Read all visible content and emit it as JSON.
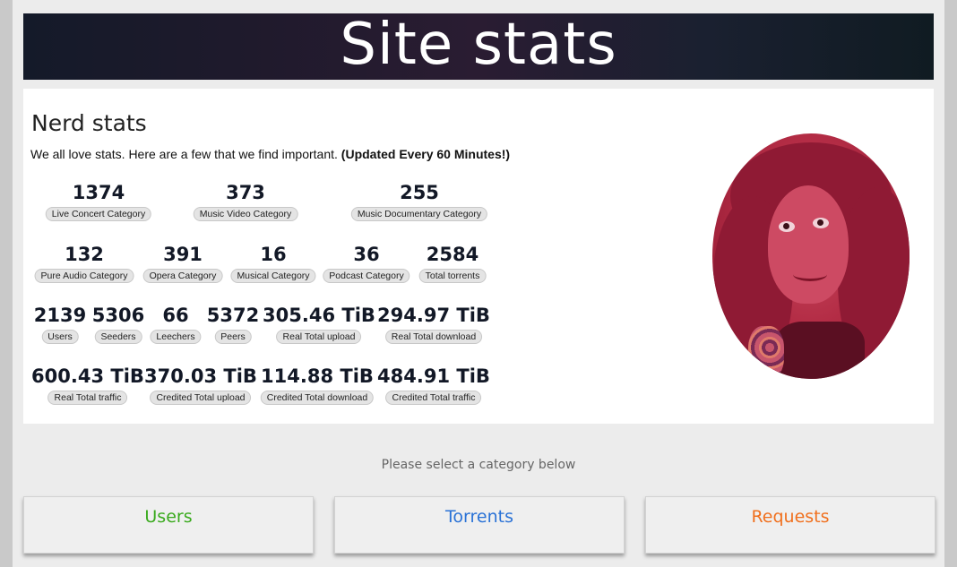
{
  "header": {
    "title": "Site stats"
  },
  "nerd": {
    "heading": "Nerd stats",
    "intro": "We all love stats. Here are a few that we find important.",
    "intro_bold": "(Updated Every 60 Minutes!)",
    "rows": [
      [
        {
          "value": "1374",
          "label": "Live Concert Category"
        },
        {
          "value": "373",
          "label": "Music Video Category"
        },
        {
          "value": "255",
          "label": "Music Documentary Category"
        }
      ],
      [
        {
          "value": "132",
          "label": "Pure Audio Category"
        },
        {
          "value": "391",
          "label": "Opera Category"
        },
        {
          "value": "16",
          "label": "Musical Category"
        },
        {
          "value": "36",
          "label": "Podcast Category"
        },
        {
          "value": "2584",
          "label": "Total torrents"
        }
      ],
      [
        {
          "value": "2139",
          "label": "Users"
        },
        {
          "value": "5306",
          "label": "Seeders"
        },
        {
          "value": "66",
          "label": "Leechers"
        },
        {
          "value": "5372",
          "label": "Peers"
        },
        {
          "value": "305.46 TiB",
          "label": "Real Total upload"
        },
        {
          "value": "294.97 TiB",
          "label": "Real Total download"
        }
      ],
      [
        {
          "value": "600.43 TiB",
          "label": "Real Total traffic"
        },
        {
          "value": "370.03 TiB",
          "label": "Credited Total upload"
        },
        {
          "value": "114.88 TiB",
          "label": "Credited Total download"
        },
        {
          "value": "484.91 TiB",
          "label": "Credited Total traffic"
        }
      ]
    ]
  },
  "footer": {
    "prompt": "Please select a category below",
    "categories": [
      {
        "label": "Users",
        "color": "#3aaa1e"
      },
      {
        "label": "Torrents",
        "color": "#2a72d6"
      },
      {
        "label": "Requests",
        "color": "#f0701e"
      }
    ]
  }
}
